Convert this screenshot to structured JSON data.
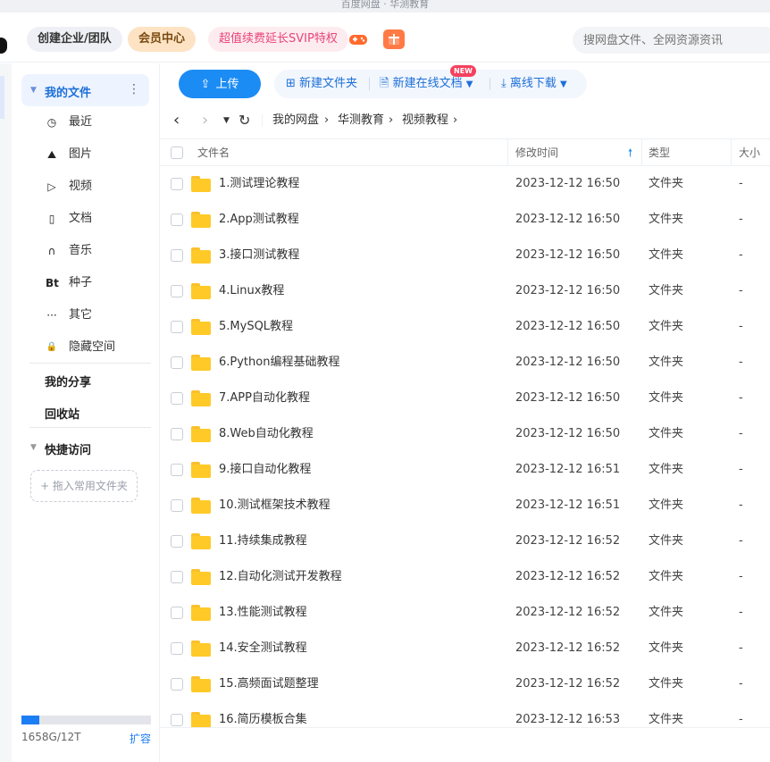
{
  "window": {
    "title": "百度网盘 · 华测教育"
  },
  "topbar": {
    "team_label": "创建企业/团队",
    "vip_label": "会员中心",
    "svip_label": "超值续费延长SVIP特权",
    "search_placeholder": "搜网盘文件、全网资源资讯",
    "accent": "#1c8cf5"
  },
  "sidebar": {
    "my_files": "我的文件",
    "items": [
      {
        "icon": "clock-icon",
        "glyph": "◷",
        "label": "最近"
      },
      {
        "icon": "image-icon",
        "glyph": "⛰",
        "label": "图片"
      },
      {
        "icon": "video-icon",
        "glyph": "▷",
        "label": "视频"
      },
      {
        "icon": "document-icon",
        "glyph": "▯",
        "label": "文档"
      },
      {
        "icon": "headphones-icon",
        "glyph": "∩",
        "label": "音乐"
      },
      {
        "icon": "bt-icon",
        "glyph": "Bt",
        "label": "种子"
      },
      {
        "icon": "more-icon",
        "glyph": "···",
        "label": "其它"
      },
      {
        "icon": "lock-icon",
        "glyph": "🔒",
        "label": "隐藏空间"
      }
    ],
    "my_share": "我的分享",
    "recycle": "回收站",
    "quick_access": "快捷访问",
    "drop_hint": "+ 拖入常用文件夹",
    "quota_text": "1658G/12T",
    "quota_fraction": 0.135,
    "expand_label": "扩容"
  },
  "toolbar": {
    "upload": "上传",
    "new_folder": "新建文件夹",
    "new_online_doc": "新建在线文档",
    "new_badge": "NEW",
    "offline_download": "离线下载"
  },
  "breadcrumb": [
    "我的网盘",
    "华测教育",
    "视频教程"
  ],
  "table": {
    "headers": {
      "name": "文件名",
      "modified": "修改时间",
      "type": "类型",
      "size": "大小"
    },
    "rows": [
      {
        "name": "1.测试理论教程",
        "modified": "2023-12-12 16:50",
        "type": "文件夹",
        "size": "-"
      },
      {
        "name": "2.App测试教程",
        "modified": "2023-12-12 16:50",
        "type": "文件夹",
        "size": "-"
      },
      {
        "name": "3.接口测试教程",
        "modified": "2023-12-12 16:50",
        "type": "文件夹",
        "size": "-"
      },
      {
        "name": "4.Linux教程",
        "modified": "2023-12-12 16:50",
        "type": "文件夹",
        "size": "-"
      },
      {
        "name": "5.MySQL教程",
        "modified": "2023-12-12 16:50",
        "type": "文件夹",
        "size": "-"
      },
      {
        "name": "6.Python编程基础教程",
        "modified": "2023-12-12 16:50",
        "type": "文件夹",
        "size": "-"
      },
      {
        "name": "7.APP自动化教程",
        "modified": "2023-12-12 16:50",
        "type": "文件夹",
        "size": "-"
      },
      {
        "name": "8.Web自动化教程",
        "modified": "2023-12-12 16:50",
        "type": "文件夹",
        "size": "-"
      },
      {
        "name": "9.接口自动化教程",
        "modified": "2023-12-12 16:51",
        "type": "文件夹",
        "size": "-"
      },
      {
        "name": "10.测试框架技术教程",
        "modified": "2023-12-12 16:51",
        "type": "文件夹",
        "size": "-"
      },
      {
        "name": "11.持续集成教程",
        "modified": "2023-12-12 16:52",
        "type": "文件夹",
        "size": "-"
      },
      {
        "name": "12.自动化测试开发教程",
        "modified": "2023-12-12 16:52",
        "type": "文件夹",
        "size": "-"
      },
      {
        "name": "13.性能测试教程",
        "modified": "2023-12-12 16:52",
        "type": "文件夹",
        "size": "-"
      },
      {
        "name": "14.安全测试教程",
        "modified": "2023-12-12 16:52",
        "type": "文件夹",
        "size": "-"
      },
      {
        "name": "15.高频面试题整理",
        "modified": "2023-12-12 16:52",
        "type": "文件夹",
        "size": "-"
      },
      {
        "name": "16.简历模板合集",
        "modified": "2023-12-12 16:53",
        "type": "文件夹",
        "size": "-"
      }
    ]
  }
}
